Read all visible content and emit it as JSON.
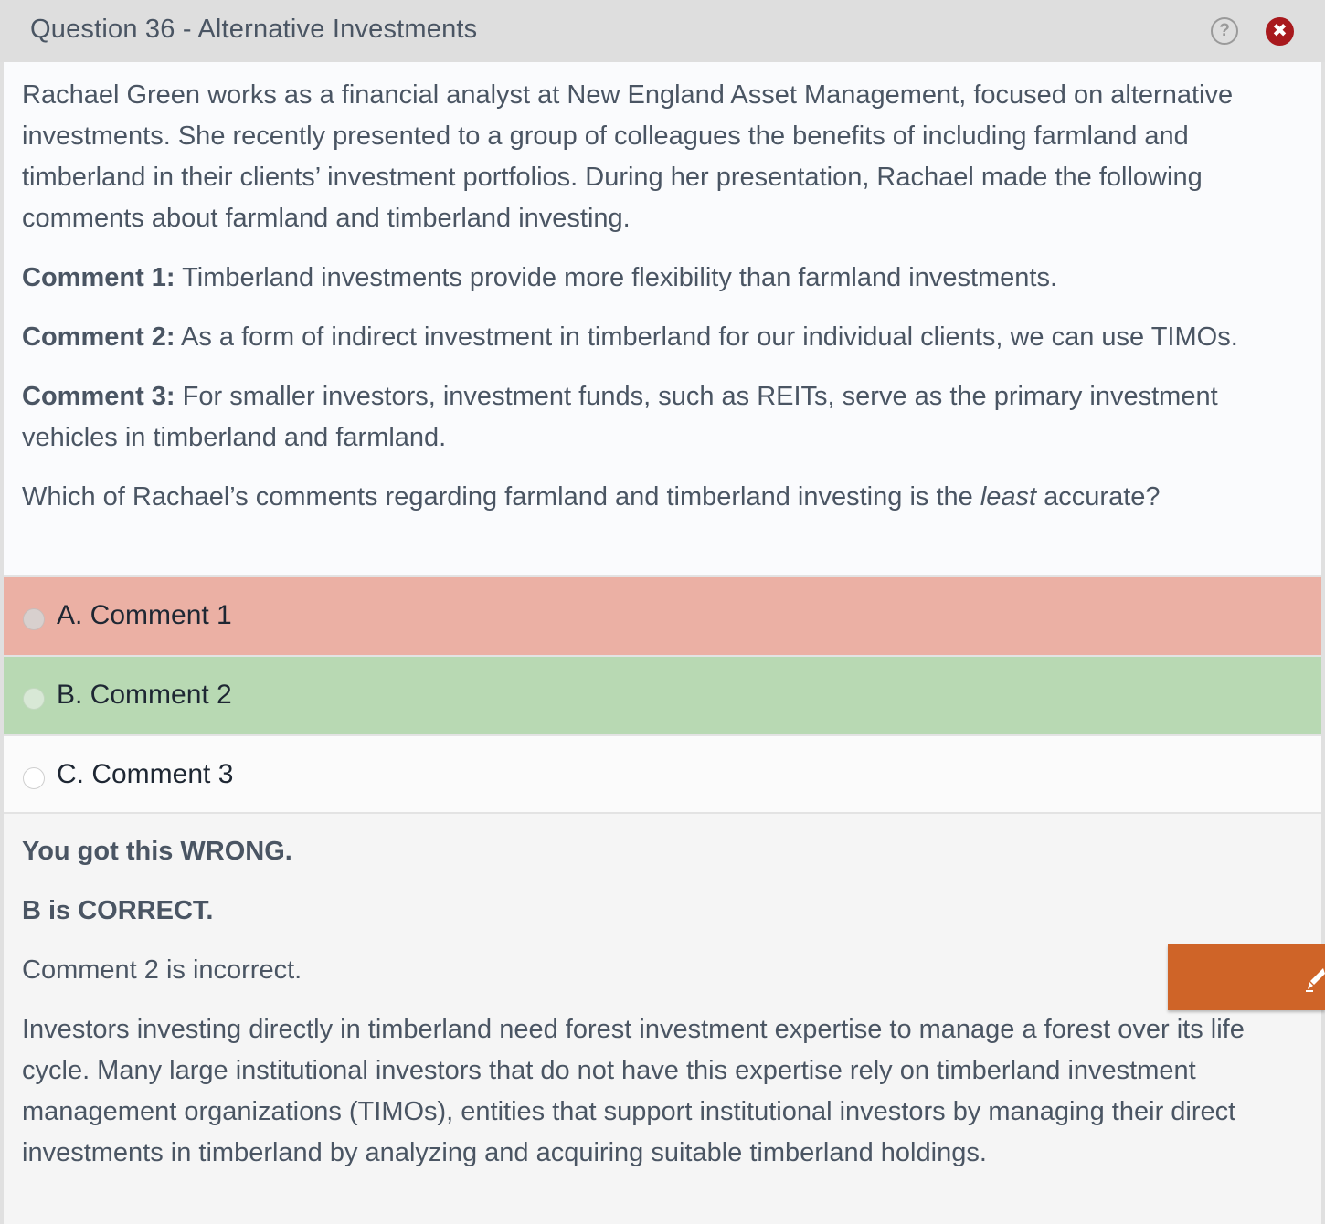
{
  "window": {
    "title": "Question 36 - Alternative Investments",
    "help_icon": "?",
    "close_icon": "✖"
  },
  "question": {
    "intro": "Rachael Green works as a financial analyst at New England Asset Management, focused on alternative investments.  She recently presented to a group of colleagues the benefits of including farmland and timberland in their clients’ investment portfolios.  During her presentation, Rachael made the following comments about farmland and timberland investing.",
    "comments": [
      {
        "label": "Comment 1:",
        "text": " Timberland investments provide more flexibility than farmland investments."
      },
      {
        "label": "Comment 2:",
        "text": " As a form of indirect investment in timberland for our individual clients, we can use TIMOs."
      },
      {
        "label": "Comment 3:",
        "text": " For smaller investors, investment funds, such as REITs, serve as the primary investment vehicles in timberland and farmland."
      }
    ],
    "prompt_before": "Which of Rachael’s comments regarding farmland and timberland investing is the ",
    "prompt_emphasis": "least",
    "prompt_after": " accurate?"
  },
  "answers": [
    {
      "label": "A. Comment 1",
      "state": "wrong"
    },
    {
      "label": "B. Comment 2",
      "state": "correct"
    },
    {
      "label": "C. Comment 3",
      "state": "neutral"
    }
  ],
  "feedback": {
    "result": "You got this WRONG.",
    "correct_answer": "B is CORRECT.",
    "summary": "Comment 2 is incorrect.",
    "explanation": "Investors investing directly in timberland need forest investment expertise to manage a forest over its life cycle.  Many large institutional investors that do not have this expertise rely on timberland investment management organizations (TIMOs), entities that support institutional investors by managing their direct investments in timberland by analyzing and acquiring suitable timberland holdings."
  },
  "colors": {
    "wrong": "#ebb0a4",
    "correct": "#b8d9b3",
    "close": "#a8191d",
    "pen_tab": "#cf6428"
  },
  "icons": {
    "help": "help-icon",
    "close": "close-icon",
    "pen": "pen-icon"
  }
}
